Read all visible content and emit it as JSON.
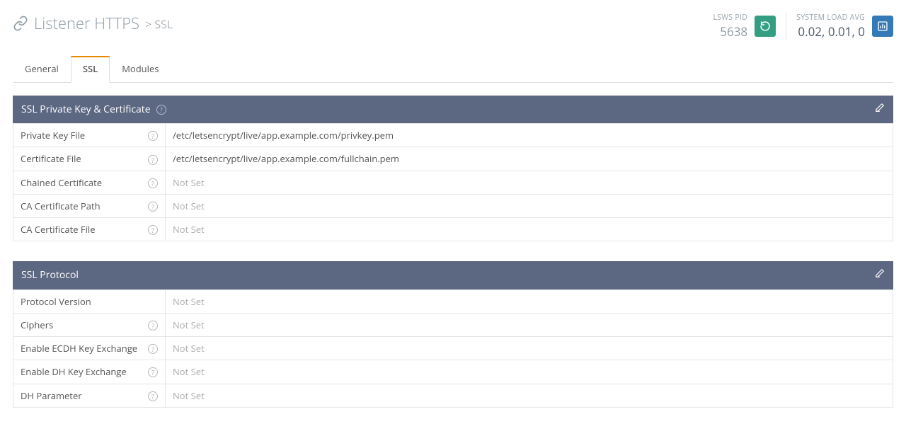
{
  "header": {
    "breadcrumb_prefix": "Listener HTTPS",
    "breadcrumb_sep": ">",
    "breadcrumb_current": "SSL"
  },
  "stats": {
    "pid_label": "LSWS PID",
    "pid_value": "5638",
    "load_label": "SYSTEM LOAD AVG",
    "load_value": "0.02, 0.01, 0"
  },
  "tabs": [
    {
      "label": "General",
      "active": false
    },
    {
      "label": "SSL",
      "active": true
    },
    {
      "label": "Modules",
      "active": false
    }
  ],
  "not_set_text": "Not Set",
  "panels": [
    {
      "title": "SSL Private Key & Certificate",
      "header_help": true,
      "rows": [
        {
          "label": "Private Key File",
          "help": true,
          "value": "/etc/letsencrypt/live/app.example.com/privkey.pem",
          "not_set": false
        },
        {
          "label": "Certificate File",
          "help": true,
          "value": "/etc/letsencrypt/live/app.example.com/fullchain.pem",
          "not_set": false
        },
        {
          "label": "Chained Certificate",
          "help": true,
          "value": "Not Set",
          "not_set": true
        },
        {
          "label": "CA Certificate Path",
          "help": true,
          "value": "Not Set",
          "not_set": true
        },
        {
          "label": "CA Certificate File",
          "help": true,
          "value": "Not Set",
          "not_set": true
        }
      ]
    },
    {
      "title": "SSL Protocol",
      "header_help": false,
      "rows": [
        {
          "label": "Protocol Version",
          "help": false,
          "value": "Not Set",
          "not_set": true
        },
        {
          "label": "Ciphers",
          "help": true,
          "value": "Not Set",
          "not_set": true
        },
        {
          "label": "Enable ECDH Key Exchange",
          "help": true,
          "value": "Not Set",
          "not_set": true
        },
        {
          "label": "Enable DH Key Exchange",
          "help": true,
          "value": "Not Set",
          "not_set": true
        },
        {
          "label": "DH Parameter",
          "help": true,
          "value": "Not Set",
          "not_set": true
        }
      ]
    }
  ]
}
